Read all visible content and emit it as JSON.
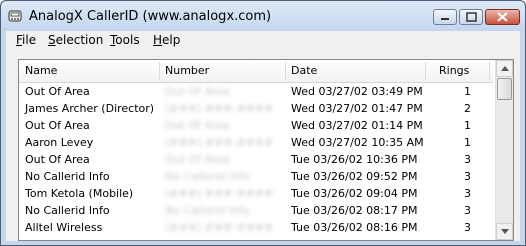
{
  "window": {
    "title": "AnalogX CallerID (www.analogx.com)",
    "accent": "#c6d7ec"
  },
  "menu": {
    "items": [
      {
        "label_pre": "",
        "label_ul": "F",
        "label_post": "ile"
      },
      {
        "label_pre": "",
        "label_ul": "S",
        "label_post": "election"
      },
      {
        "label_pre": "",
        "label_ul": "T",
        "label_post": "ools"
      },
      {
        "label_pre": "",
        "label_ul": "H",
        "label_post": "elp"
      }
    ]
  },
  "list": {
    "columns": [
      "Name",
      "Number",
      "Date",
      "Rings"
    ],
    "rows": [
      {
        "name": "Out Of Area",
        "number": "Out Of Area",
        "date": "Wed 03/27/02  03:49 PM",
        "rings": "1"
      },
      {
        "name": "James Archer (Director)",
        "number": "(###) ###-####",
        "date": "Wed 03/27/02  01:47 PM",
        "rings": "2"
      },
      {
        "name": "Out Of Area",
        "number": "Out Of Area",
        "date": "Wed 03/27/02  01:14 PM",
        "rings": "1"
      },
      {
        "name": "Aaron Levey",
        "number": "(###) ###-####",
        "date": "Wed 03/27/02  10:35 AM",
        "rings": "1"
      },
      {
        "name": "Out Of Area",
        "number": "Out Of Area",
        "date": "Tue 03/26/02  10:36 PM",
        "rings": "3"
      },
      {
        "name": "No Callerid Info",
        "number": "No Callerid Info",
        "date": "Tue 03/26/02  09:52 PM",
        "rings": "3"
      },
      {
        "name": "Tom Ketola (Mobile)",
        "number": "(###) ###-####",
        "date": "Tue 03/26/02  09:04 PM",
        "rings": "3"
      },
      {
        "name": "No Callerid Info",
        "number": "No Callerid Info",
        "date": "Tue 03/26/02  08:17 PM",
        "rings": "3"
      },
      {
        "name": "Alltel Wireless",
        "number": "(###) ###-####",
        "date": "Tue 03/26/02  08:16 PM",
        "rings": "3"
      }
    ]
  }
}
